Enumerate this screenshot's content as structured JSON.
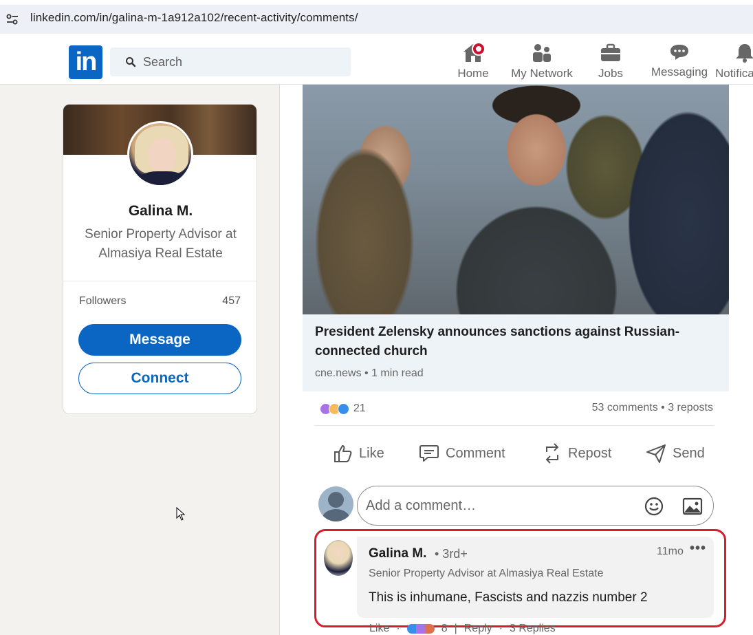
{
  "browser": {
    "url": "linkedin.com/in/galina-m-1a912a102/recent-activity/comments/"
  },
  "nav": {
    "logo_text": "in",
    "search_placeholder": "Search",
    "items": [
      {
        "label": "Home",
        "icon": "home-icon"
      },
      {
        "label": "My Network",
        "icon": "network-icon"
      },
      {
        "label": "Jobs",
        "icon": "briefcase-icon"
      },
      {
        "label": "Messaging",
        "icon": "messaging-icon"
      },
      {
        "label": "Notifica",
        "icon": "bell-icon"
      }
    ]
  },
  "profile": {
    "name": "Galina M.",
    "title": "Senior Property Advisor at Almasiya Real Estate",
    "followers_label": "Followers",
    "followers_count": "457",
    "message_button": "Message",
    "connect_button": "Connect"
  },
  "post": {
    "article_title": "President Zelensky announces sanctions against Russian-connected church",
    "article_meta": "cne.news • 1 min read",
    "reaction_count": "21",
    "comments_stat": "53 comments • 3 reposts",
    "actions": {
      "like": "Like",
      "comment": "Comment",
      "repost": "Repost",
      "send": "Send"
    },
    "comment_placeholder": "Add a comment…"
  },
  "comment": {
    "author": "Galina M.",
    "degree": "• 3rd+",
    "time": "11mo",
    "more": "•••",
    "headline": "Senior Property Advisor at Almasiya Real Estate",
    "text": "This is inhumane, Fascists and nazzis number 2",
    "footer_like": "Like",
    "footer_reaction_count": "8",
    "footer_reply": "Reply",
    "footer_replies": "3 Replies"
  },
  "colors": {
    "brand": "#0a66c2",
    "highlight": "#d21f2b",
    "notification": "#cb112d"
  }
}
